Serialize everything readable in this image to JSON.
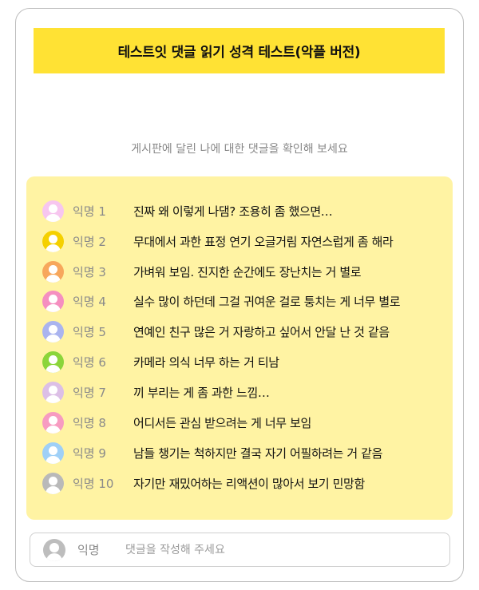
{
  "header": {
    "title": "테스트잇 댓글 읽기 성격 테스트(악플 버전)"
  },
  "subtitle": "게시판에 달린 나에 대한 댓글을 확인해 보세요",
  "comments": [
    {
      "user": "익명 1",
      "text": "진짜 왜 이렇게 나댐? 조용히 좀 했으면…",
      "avatar_color": "#f7c6ef"
    },
    {
      "user": "익명 2",
      "text": "무대에서 과한 표정 연기 오글거림 자연스럽게 좀 해라",
      "avatar_color": "#f5d000"
    },
    {
      "user": "익명 3",
      "text": "가벼워 보임. 진지한 순간에도 장난치는 거 별로",
      "avatar_color": "#f7a75c"
    },
    {
      "user": "익명 4",
      "text": "실수 많이 하던데 그걸 귀여운 걸로 퉁치는 게 너무 별로",
      "avatar_color": "#f58fc0"
    },
    {
      "user": "익명 5",
      "text": "연예인 친구 많은 거 자랑하고 싶어서 안달 난 것 같음",
      "avatar_color": "#aab4ef"
    },
    {
      "user": "익명 6",
      "text": "카메라 의식 너무 하는 거 티남",
      "avatar_color": "#8bd53a"
    },
    {
      "user": "익명 7",
      "text": "끼 부리는 게 좀 과한 느낌…",
      "avatar_color": "#dcbfe6"
    },
    {
      "user": "익명 8",
      "text": "어디서든 관심 받으려는 게 너무 보임",
      "avatar_color": "#f79bc1"
    },
    {
      "user": "익명 9",
      "text": "남들 챙기는 척하지만 결국 자기 어필하려는 거 같음",
      "avatar_color": "#9fd0f7"
    },
    {
      "user": "익명 10",
      "text": "자기만 재밌어하는 리액션이 많아서 보기 민망함",
      "avatar_color": "#b9b9b9"
    }
  ],
  "comment_input": {
    "user": "익명",
    "placeholder": "댓글을 작성해 주세요",
    "value": "",
    "avatar_color": "#bdbdbd"
  }
}
